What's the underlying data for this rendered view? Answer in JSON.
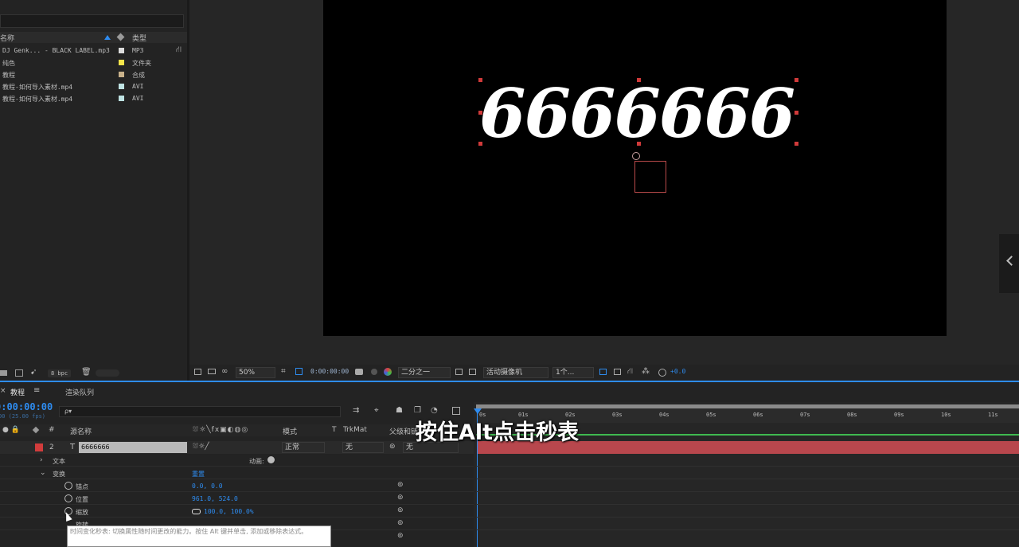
{
  "project": {
    "headers": {
      "name": "名称",
      "type": "类型"
    },
    "items": [
      {
        "name": "DJ Genk... - BLACK LABEL.mp3",
        "type": "MP3",
        "color": "#dcdcdc"
      },
      {
        "name": "纯色",
        "type": "文件夹",
        "color": "#f5e44a"
      },
      {
        "name": "教程",
        "type": "合成",
        "color": "#c9b28b"
      },
      {
        "name": "教程-如何导入素材.mp4",
        "type": "AVI",
        "color": "#bfe3e3"
      },
      {
        "name": "教程-如何导入素材.mp4",
        "type": "AVI",
        "color": "#bfe3e3"
      }
    ],
    "bpc": "8 bpc"
  },
  "comp": {
    "text": "6666666",
    "zoom": "50%",
    "timecode": "0:00:00:00",
    "resolution": "二分之一",
    "camera": "活动摄像机",
    "views": "1个...",
    "exposure": "+0.0"
  },
  "timeline": {
    "tab_active": "教程",
    "tab_render": "渲染队列",
    "timecode": "0:00:00:00",
    "fps": "00 (25.00 fps)",
    "search_placeholder": "ρ▾",
    "columns": {
      "source": "源名称",
      "mode": "模式",
      "t": "T",
      "trkmat": "TrkMat",
      "parent": "父级和链接"
    },
    "layer": {
      "num": "2",
      "type_icon": "T",
      "name": "6666666",
      "mode": "正常",
      "trkmat": "无",
      "parent": "无"
    },
    "props": {
      "text": "文本",
      "animate": "动画:",
      "transform": "变换",
      "reset": "重置",
      "anchor": {
        "label": "锚点",
        "value": "0.0, 0.0"
      },
      "position": {
        "label": "位置",
        "value": "961.0, 524.0"
      },
      "scale": {
        "label": "缩放",
        "value": "100.0, 100.0%"
      },
      "rotation": {
        "label": "旋转",
        "value": ""
      }
    },
    "ruler": [
      "0s",
      "01s",
      "02s",
      "03s",
      "04s",
      "05s",
      "06s",
      "07s",
      "08s",
      "09s",
      "10s",
      "11s"
    ],
    "caption": "按住Alt点击秒表",
    "tooltip": "时间变化秒表: 切换属性随时间更改的能力。按住 Alt 键并单击, 添加或移除表达式。"
  },
  "colors": {
    "accent": "#2e8cf0",
    "layer_bar": "#b8474d",
    "label_red": "#d23c3c"
  }
}
